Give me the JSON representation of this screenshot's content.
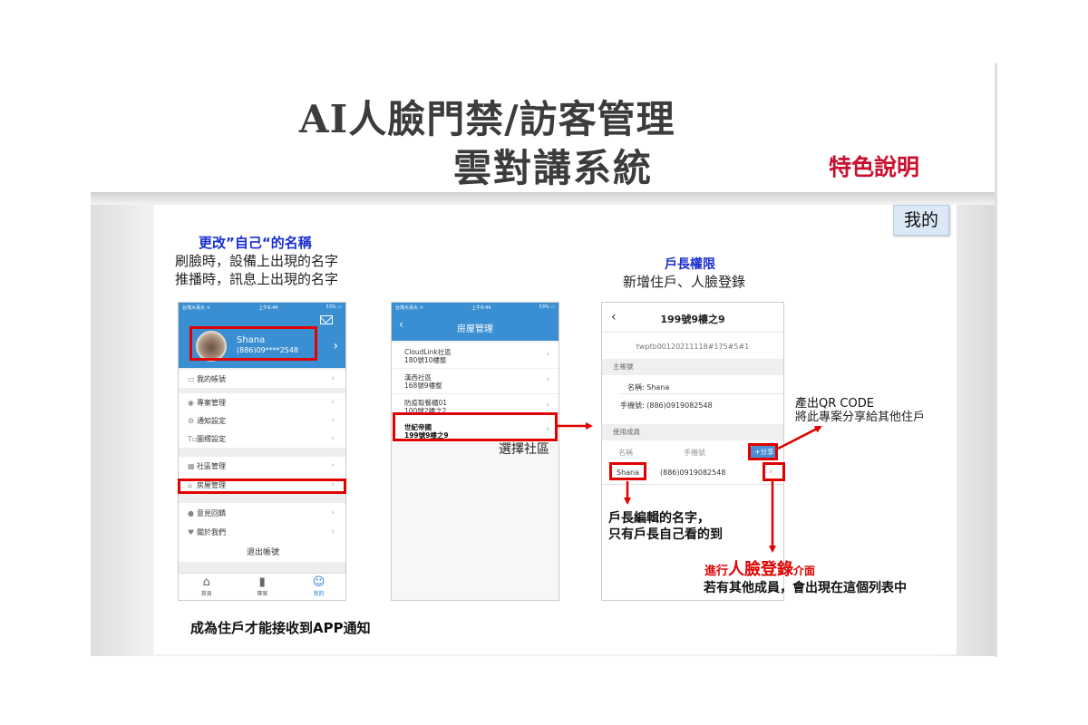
{
  "slide": {
    "title_line1": "AI人臉門禁/訪客管理",
    "title_line2": "雲對講系統",
    "feature_label": "特色說明",
    "tag": "我的"
  },
  "annotations": {
    "rename_heading": "更改”自己“的名稱",
    "rename_line1": "刷臉時，設備上出現的名字",
    "rename_line2": "推播時，訊息上出現的名字",
    "owner_heading": "戶長權限",
    "owner_line": "新增住戶、人臉登錄",
    "select_community": "選擇社區",
    "qr_line1": "產出QR CODE",
    "qr_line2": "將此專案分享給其他住戶",
    "owner_name_line1": "戶長編輯的名字，",
    "owner_name_line2": "只有戶長自己看的到",
    "face_prefix": "進行",
    "face_main": "人臉登錄",
    "face_suffix": "介面",
    "other_members": "若有其他成員，會出現在這個列表中",
    "footer": "成為住戶才能接收到APP通知"
  },
  "phone1": {
    "status_left": "台灣大哥大 ᯤ",
    "status_center": "上午6:44",
    "status_right": "53% ▭",
    "user_name": "Shana",
    "user_phone": "(886)09****2548",
    "menu": [
      {
        "icon": "▭",
        "label": "我的帳號"
      },
      {
        "icon": "◉",
        "label": "專案管理"
      },
      {
        "icon": "⚙",
        "label": "通知設定"
      },
      {
        "icon": "T▫",
        "label": "圖標設定"
      },
      {
        "icon": "▦",
        "label": "社區管理"
      },
      {
        "icon": "⌂",
        "label": "房屋管理"
      },
      {
        "icon": "●",
        "label": "意見回饋"
      },
      {
        "icon": "♥",
        "label": "關於我們"
      }
    ],
    "logout": "退出帳號",
    "tabs": [
      {
        "icon": "⌂",
        "label": "首頁"
      },
      {
        "icon": "▮",
        "label": "專案"
      },
      {
        "icon": "☺",
        "label": "我的"
      }
    ]
  },
  "phone2": {
    "status_left": "台灣大哥大 ᯤ",
    "status_center": "上午6:44",
    "status_right": "53% ▭",
    "title": "房屋管理",
    "communities": [
      {
        "name": "CloudLink社區",
        "unit": "180號10樓整"
      },
      {
        "name": "漢西社區",
        "unit": "168號9樓整"
      },
      {
        "name": "防疫取餐櫃01",
        "unit": "100號2樓之2"
      },
      {
        "name": "世紀帝國",
        "unit": "199號9樓之9"
      }
    ]
  },
  "phone3": {
    "title": "199號9樓之9",
    "project_id": "twptb00120211118#175#5#1",
    "main_account_section": "主帳號",
    "name_label": "名稱: Shana",
    "phone_label": "手機號: (886)0919082548",
    "members_section": "使用成員",
    "col_name": "名稱",
    "col_phone": "手機號",
    "share_button": "+分享",
    "member_name": "Shana",
    "member_phone": "(886)0919082548"
  }
}
